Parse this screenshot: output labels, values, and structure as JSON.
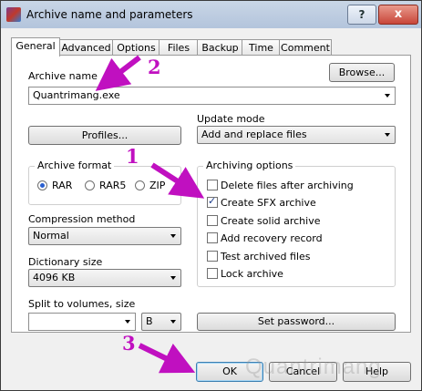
{
  "window": {
    "title": "Archive name and parameters",
    "help_label": "?",
    "close_label": "x"
  },
  "tabs": [
    {
      "label": "General",
      "active": true
    },
    {
      "label": "Advanced"
    },
    {
      "label": "Options"
    },
    {
      "label": "Files"
    },
    {
      "label": "Backup"
    },
    {
      "label": "Time"
    },
    {
      "label": "Comment"
    }
  ],
  "archive_name": {
    "label": "Archive name",
    "value": "Quantrimang.exe",
    "browse_label": "Browse..."
  },
  "profiles_label": "Profiles...",
  "update_mode": {
    "label": "Update mode",
    "value": "Add and replace files"
  },
  "archive_format": {
    "label": "Archive format",
    "options": [
      "RAR",
      "RAR5",
      "ZIP"
    ],
    "selected": "RAR"
  },
  "archiving_options": {
    "label": "Archiving options",
    "items": [
      {
        "label": "Delete files after archiving",
        "checked": false
      },
      {
        "label": "Create SFX archive",
        "checked": true
      },
      {
        "label": "Create solid archive",
        "checked": false
      },
      {
        "label": "Add recovery record",
        "checked": false
      },
      {
        "label": "Test archived files",
        "checked": false
      },
      {
        "label": "Lock archive",
        "checked": false
      }
    ]
  },
  "compression": {
    "label": "Compression method",
    "value": "Normal"
  },
  "dictionary": {
    "label": "Dictionary size",
    "value": "4096 KB"
  },
  "split": {
    "label": "Split to volumes, size",
    "value": "",
    "unit": "B"
  },
  "set_password_label": "Set password...",
  "buttons": {
    "ok": "OK",
    "cancel": "Cancel",
    "help": "Help"
  },
  "annotations": {
    "step1": "1",
    "step2": "2",
    "step3": "3",
    "color": "#c010c0"
  },
  "watermark": "Quantrimang"
}
